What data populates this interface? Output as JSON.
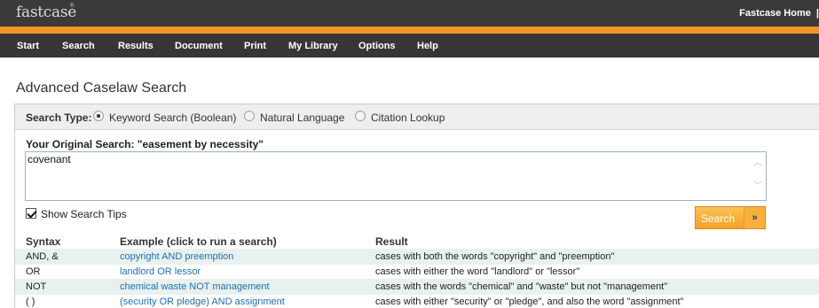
{
  "header": {
    "logo_text": "fastcase",
    "logo_tm": "®",
    "links": [
      "Fastcase Home",
      "|"
    ]
  },
  "menu": {
    "items": [
      "Start",
      "Search",
      "Results",
      "Document",
      "Print",
      "My Library",
      "Options",
      "Help"
    ]
  },
  "page": {
    "title": "Advanced Caselaw Search"
  },
  "form": {
    "search_type_label": "Search Type:",
    "search_types": [
      {
        "label": "Keyword Search (Boolean)",
        "selected": true
      },
      {
        "label": "Natural Language",
        "selected": false
      },
      {
        "label": "Citation Lookup",
        "selected": false
      }
    ],
    "original_search": "Your Original Search:  \"easement by necessity\"",
    "query_value": "covenant",
    "show_tips_label": "Show Search Tips",
    "show_tips_checked": true,
    "search_button_label": "Search",
    "search_button_arrow": "»"
  },
  "tips": {
    "headers": [
      "Syntax",
      "Example (click to run a search)",
      "Result"
    ],
    "rows": [
      {
        "syntax": "AND, &",
        "example": "copyright AND preemption",
        "result": "cases with both the words \"copyright\" and \"preemption\""
      },
      {
        "syntax": "OR",
        "example": "landlord OR lessor",
        "result": "cases with either the word \"landlord\" or \"lessor\""
      },
      {
        "syntax": "NOT",
        "example": "chemical waste NOT management",
        "result": "cases with the words \"chemical\" and \"waste\" but not \"management\""
      },
      {
        "syntax": "( )",
        "example": "(security OR pledge) AND assignment",
        "result": "cases with either \"security\" or \"pledge\", and also the word \"assignment\""
      }
    ]
  },
  "colors": {
    "accent_orange": "#f39321",
    "menu_bg": "#363636",
    "link_blue": "#1e6fb0"
  }
}
